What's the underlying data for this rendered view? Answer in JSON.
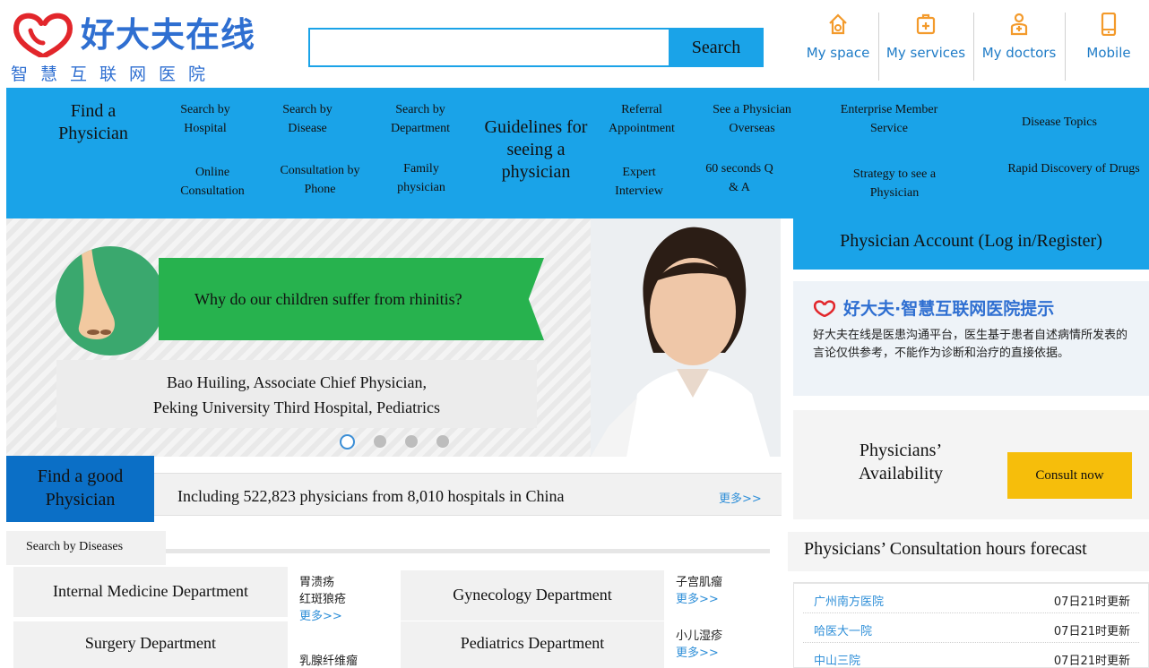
{
  "header": {
    "logo_name": "好大夫在线",
    "logo_slogan": "智慧互联网医院",
    "search_placeholder": "",
    "search_button": "Search",
    "quick_links": [
      {
        "label": "My space",
        "icon": "house-icon"
      },
      {
        "label": "My services",
        "icon": "medical-kit-icon"
      },
      {
        "label": "My doctors",
        "icon": "doctor-icon"
      },
      {
        "label": "Mobile",
        "icon": "phone-icon"
      }
    ]
  },
  "nav": {
    "find_physician": "Find a Physician",
    "search_by_hospital": "Search by Hospital",
    "search_by_disease": "Search by Disease",
    "search_by_department": "Search by Department",
    "guidelines": "Guidelines for seeing a physician",
    "referral_appointment": "Referral Appointment",
    "see_overseas": "See a Physician Overseas",
    "enterprise_member": "Enterprise Member Service",
    "disease_topics": "Disease Topics",
    "online_consultation": "Online Consultation",
    "phone_consultation": "Consultation by Phone",
    "family_physician": "Family physician",
    "expert_interview": "Expert Interview",
    "sixty_seconds": "60 seconds Q & A",
    "strategy": "Strategy to see a Physician",
    "rapid_drugs": "Rapid Discovery of Drugs"
  },
  "banner": {
    "headline": "Why do our children suffer from rhinitis?",
    "caption_line1": "Bao Huiling, Associate Chief Physician,",
    "caption_line2": "Peking University Third Hospital, Pediatrics",
    "slides": 4,
    "active_slide": 1
  },
  "find_good": {
    "title": "Find a good Physician",
    "stats": "Including 522,823 physicians from 8,010 hospitals in China",
    "more": "更多>>",
    "tab": "Search by Diseases",
    "departments": [
      {
        "name": "Internal Medicine Department",
        "diseases": [
          "胃溃疡",
          "红斑狼疮"
        ],
        "more": "更多>>"
      },
      {
        "name": "Surgery Department",
        "diseases": [
          "乳腺纤维瘤"
        ],
        "more": ""
      },
      {
        "name": "Gynecology Department",
        "diseases": [
          "子宫肌瘤"
        ],
        "more": "更多>>"
      },
      {
        "name": "Pediatrics Department",
        "diseases": [
          "小儿湿疹"
        ],
        "more": "更多>>"
      }
    ]
  },
  "sidebar": {
    "account": "Physician Account (Log in/Register)",
    "notice_title": "好大夫·智慧互联网医院提示",
    "notice_body": "好大夫在线是医患沟通平台，医生基于患者自述病情所发表的言论仅供参考，不能作为诊断和治疗的直接依据。",
    "availability": "Physicians’ Availability",
    "consult_button": "Consult now",
    "forecast_title": "Physicians’ Consultation hours forecast",
    "forecast": [
      {
        "hospital": "广州南方医院",
        "time": "07日21时更新"
      },
      {
        "hospital": "哈医大一院",
        "time": "07日21时更新"
      },
      {
        "hospital": "中山三院",
        "time": "07日21时更新"
      }
    ]
  },
  "colors": {
    "brand_blue": "#2f6fd1",
    "nav_blue": "#1aa3e8",
    "dark_blue": "#0b6fc6",
    "consult_yellow": "#f6be0b",
    "banner_green": "#27b24e",
    "link_blue": "#2f8fd8"
  }
}
